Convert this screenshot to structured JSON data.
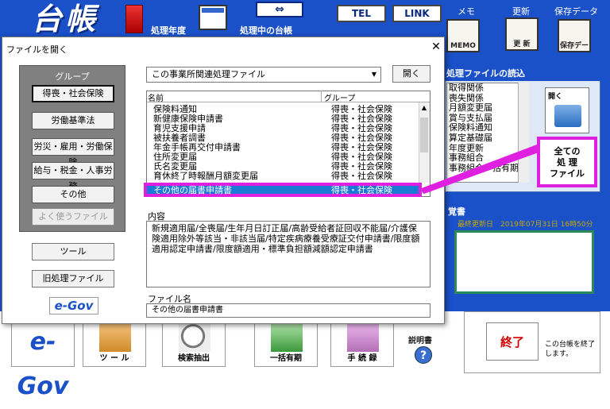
{
  "app": {
    "logo_text": "台帳",
    "year_label": "処理年度",
    "current_book_label": "処理中の台帳",
    "arrow_button": "⇔",
    "tel_label": "TEL",
    "link_label": "LINK",
    "memo_caption": "メモ",
    "memo_icon_label": "MEMO",
    "update_caption": "更新",
    "update_icon_label": "更 新",
    "save_caption": "保存データ",
    "save_icon_label": "保存データ"
  },
  "right_panel": {
    "title": "処理ファイルの読込",
    "items": [
      "取得関係",
      "喪失関係",
      "月額変更届",
      "賞与支払届",
      "保険料通知",
      "算定基礎届",
      "年度更新",
      "事務組合",
      "事務組合一括有期"
    ],
    "open_label": "開く",
    "all_files_button": [
      "全ての",
      "処 理",
      "ファイル"
    ]
  },
  "notes": {
    "title": "覚書",
    "last_updated": "最終更新日　2019年07月31日 16時50分"
  },
  "toolbar": {
    "egov": "e-Gov",
    "tools_label": "ツ ー ル",
    "search_label": "検索抽出",
    "bulk_label": "一括有期",
    "proc_label": "手 続 録",
    "help_label": "説明書",
    "help_icon": "?",
    "exit_label": "終了",
    "exit_desc": "この台帳を終了します。"
  },
  "dialog": {
    "title": "ファイルを開く",
    "close": "✕",
    "group_heading": "グループ",
    "groups": [
      {
        "label": "得喪・社会保険"
      },
      {
        "label": "労働基準法"
      },
      {
        "label": "労災・雇用・労働保険"
      },
      {
        "label": "給与・税金・人事労務"
      },
      {
        "label": "その他"
      },
      {
        "label": "よく使うファイル"
      }
    ],
    "tool_button": "ツール",
    "old_proc_button": "旧処理ファイル",
    "egov_badge": "e-Gov",
    "category_value": "この事業所関連処理ファイル",
    "category_arrow": "▼",
    "open_button": "開く",
    "col_name": "名前",
    "col_group": "グループ",
    "rows": [
      {
        "name": "保険料通知",
        "group": "得喪・社会保険"
      },
      {
        "name": "新健康保険申請書",
        "group": "得喪・社会保険"
      },
      {
        "name": "育児支援申請",
        "group": "得喪・社会保険"
      },
      {
        "name": "被扶養者調書",
        "group": "得喪・社会保険"
      },
      {
        "name": "年金手帳再交付申請書",
        "group": "得喪・社会保険"
      },
      {
        "name": "住所変更届",
        "group": "得喪・社会保険"
      },
      {
        "name": "氏名変更届",
        "group": "得喪・社会保険"
      },
      {
        "name": "育休終了時報酬月額変更届",
        "group": "得喪・社会保険"
      }
    ],
    "selected_row": {
      "name": "その他の届書申請書",
      "group": "得喪・社会保険"
    },
    "scroll_up": "▲",
    "scroll_down": "▼",
    "content_label": "内容",
    "content_text": "新規適用届/全喪届/生年月日訂正届/高齢受給者証回収不能届/介護保険適用除外等該当・非該当届/特定疾病療養受療証交付申請書/限度額適用認定申請書/限度額適用・標準負担額減額認定申請書",
    "filename_label": "ファイル名",
    "filename_value": "その他の届書申請書"
  },
  "colors": {
    "app_blue": "#1a50c8",
    "highlight_magenta": "#e020e0",
    "selection_blue": "#1a7ad6",
    "exit_red": "#d00000"
  }
}
